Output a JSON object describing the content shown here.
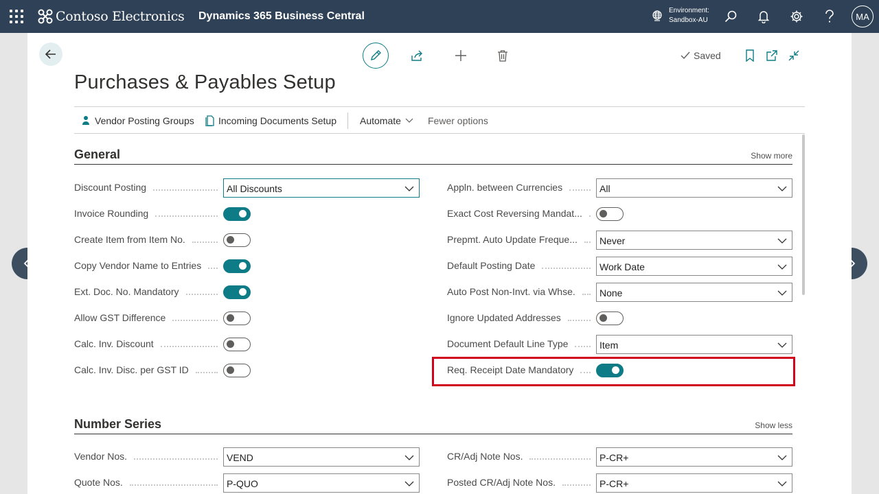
{
  "topbar": {
    "brand": "Contoso Electronics",
    "product": "Dynamics 365 Business Central",
    "environment_label": "Environment:",
    "environment_value": "Sandbox-AU",
    "avatar_initials": "MA",
    "color": "#2f4156"
  },
  "toolbar": {
    "saved_label": "Saved"
  },
  "page": {
    "title": "Purchases & Payables Setup"
  },
  "actions": {
    "vendor_posting_groups": "Vendor Posting Groups",
    "incoming_documents_setup": "Incoming Documents Setup",
    "automate": "Automate",
    "fewer_options": "Fewer options"
  },
  "general": {
    "title": "General",
    "link": "Show more",
    "left": [
      {
        "label": "Discount Posting",
        "type": "select",
        "value": "All Discounts"
      },
      {
        "label": "Invoice Rounding",
        "type": "toggle",
        "on": true
      },
      {
        "label": "Create Item from Item No.",
        "type": "toggle",
        "on": false
      },
      {
        "label": "Copy Vendor Name to Entries",
        "type": "toggle",
        "on": true
      },
      {
        "label": "Ext. Doc. No. Mandatory",
        "type": "toggle",
        "on": true
      },
      {
        "label": "Allow GST Difference",
        "type": "toggle",
        "on": false
      },
      {
        "label": "Calc. Inv. Discount",
        "type": "toggle",
        "on": false
      },
      {
        "label": "Calc. Inv. Disc. per GST ID",
        "type": "toggle",
        "on": false
      }
    ],
    "right": [
      {
        "label": "Appln. between Currencies",
        "type": "select",
        "value": "All"
      },
      {
        "label": "Exact Cost Reversing Mandat...",
        "type": "toggle",
        "on": false
      },
      {
        "label": "Prepmt. Auto Update Freque...",
        "type": "select",
        "value": "Never"
      },
      {
        "label": "Default Posting Date",
        "type": "select",
        "value": "Work Date"
      },
      {
        "label": "Auto Post Non-Invt. via Whse.",
        "type": "select",
        "value": "None"
      },
      {
        "label": "Ignore Updated Addresses",
        "type": "toggle",
        "on": false
      },
      {
        "label": "Document Default Line Type",
        "type": "select",
        "value": "Item"
      },
      {
        "label": "Req. Receipt Date Mandatory",
        "type": "toggle",
        "on": true
      }
    ]
  },
  "number_series": {
    "title": "Number Series",
    "link": "Show less",
    "left": [
      {
        "label": "Vendor Nos.",
        "type": "select",
        "value": "VEND"
      },
      {
        "label": "Quote Nos.",
        "type": "select",
        "value": "P-QUO"
      }
    ],
    "right": [
      {
        "label": "CR/Adj Note Nos.",
        "type": "select",
        "value": "P-CR+"
      },
      {
        "label": "Posted CR/Adj Note Nos.",
        "type": "select",
        "value": "P-CR+"
      }
    ]
  },
  "colors": {
    "accent": "#0e7c86",
    "highlight": "#d0021b"
  }
}
